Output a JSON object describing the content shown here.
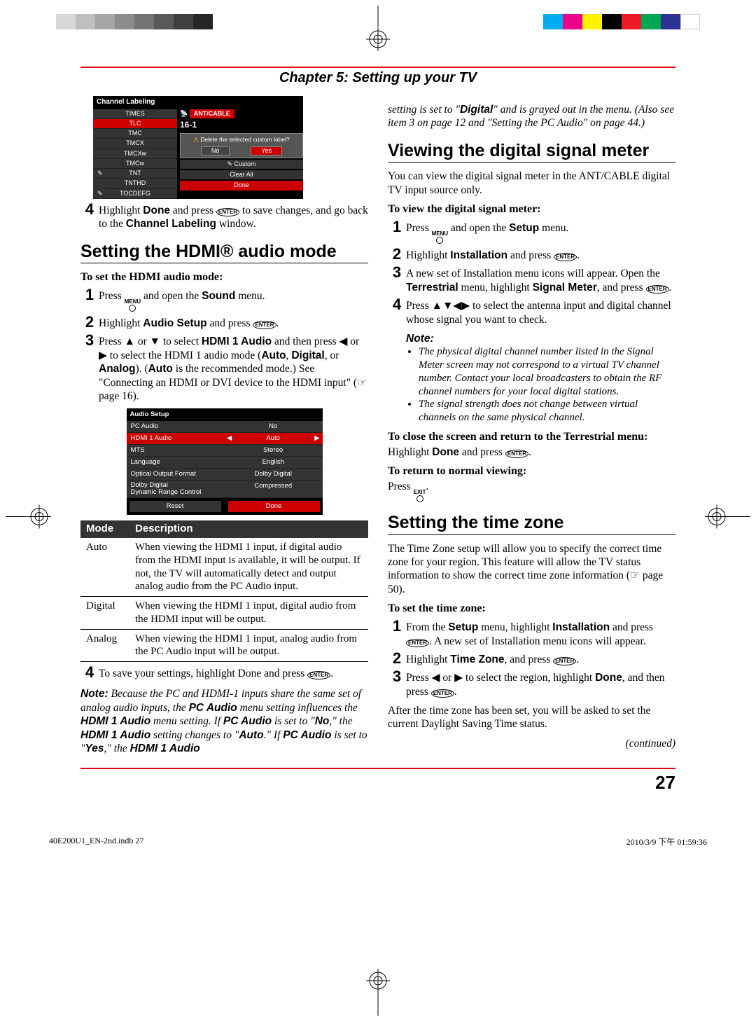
{
  "print_marks": {
    "colors_left": [
      "#d8d8d8",
      "#bfbfbf",
      "#a6a6a6",
      "#8c8c8c",
      "#737373",
      "#595959",
      "#404040",
      "#262626"
    ],
    "colors_right": [
      "#00aeef",
      "#ec008c",
      "#fff200",
      "#000000",
      "#ed1c24",
      "#00a651",
      "#2e3192",
      "#ffffff"
    ]
  },
  "chapter_title": "Chapter 5: Setting up your TV",
  "channel_labeling_ss": {
    "title": "Channel Labeling",
    "rows": [
      "TIMES",
      "TLC",
      "TMC",
      "TMCX",
      "TMCXw",
      "TMCw",
      "TNT",
      "TNTHD",
      "TOCDEFG"
    ],
    "ant": "ANT/CABLE",
    "channel": "16-1",
    "dialog": "Delete the selected custom label?",
    "no": "No",
    "yes": "Yes",
    "custom": "Custom",
    "clear": "Clear All",
    "done": "Done"
  },
  "left": {
    "step4_a": "Highlight ",
    "step4_b": "Done",
    "step4_c": " and press ",
    "step4_d": " to save changes, and go back to the ",
    "step4_e": "Channel Labeling",
    "step4_f": " window.",
    "h2_hdmi": "Setting the HDMI® audio mode",
    "sub_hdmi": "To set the HDMI audio mode:",
    "s1a": "Press ",
    "s1b": " and open the ",
    "s1c": "Sound",
    "s1d": " menu.",
    "s2a": "Highlight ",
    "s2b": "Audio Setup",
    "s2c": " and press ",
    "s3a": "Press ▲ or ▼ to select ",
    "s3b": "HDMI 1 Audio",
    "s3c": " and then press ◀ or ▶ to select the HDMI 1 audio mode (",
    "s3d": "Auto",
    "s3e": ", ",
    "s3f": "Digital",
    "s3g": ", or ",
    "s3h": "Analog",
    "s3i": "). (",
    "s3j": "Auto",
    "s3k": " is the recommended mode.) See \"Connecting an HDMI or DVI device to the HDMI input\" (☞ page 16).",
    "audio_ss": {
      "title": "Audio Setup",
      "rows": [
        {
          "l": "PC Audio",
          "r": "No"
        },
        {
          "l": "HDMI 1 Audio",
          "r": "Auto",
          "sel": true
        },
        {
          "l": "MTS",
          "r": "Stereo"
        },
        {
          "l": "Language",
          "r": "English"
        },
        {
          "l": "Optical Output Format",
          "r": "Dolby Digital"
        },
        {
          "l": "Dolby Digital Dynamic Range Control",
          "r": "Compressed"
        }
      ],
      "reset": "Reset",
      "done": "Done"
    },
    "table": {
      "h1": "Mode",
      "h2": "Description",
      "rows": [
        {
          "m": "Auto",
          "d": "When viewing the HDMI 1 input, if digital audio from the HDMI input is available, it will be output. If not, the TV will automatically detect and output analog audio from the PC Audio input."
        },
        {
          "m": "Digital",
          "d": "When viewing the HDMI 1 input, digital audio from the HDMI input will be output."
        },
        {
          "m": "Analog",
          "d": "When viewing the HDMI 1 input, analog audio from the PC Audio input will be output."
        }
      ]
    },
    "s4a": "To save your settings, highlight Done and press ",
    "note_label": "Note:",
    "note_text_parts": [
      " Because the PC and HDMI-1 inputs share the same set of analog audio inputs, the ",
      "PC Audio",
      " menu setting influences the ",
      "HDMI 1 Audio",
      " menu setting. If ",
      "PC Audio",
      " is set to \"",
      "No",
      ",\" the ",
      "HDMI 1 Audio",
      " setting changes to \"",
      "Auto",
      ".\" If ",
      "PC Audio",
      " is set to \"",
      "Yes",
      ",\" the ",
      "HDMI 1 Audio"
    ]
  },
  "right": {
    "cont_top": "setting is set to \"",
    "cont_b": "Digital",
    "cont_top2": "\" and is grayed out in the menu. (Also see item 3 on page 12 and \"Setting the PC Audio\" on page 44.)",
    "h2_signal": "Viewing the digital signal meter",
    "p_signal": "You can view the digital signal meter in the ANT/CABLE digital TV input source only.",
    "sub_view": "To view the digital signal meter:",
    "v1a": "Press ",
    "v1b": " and open the ",
    "v1c": "Setup",
    "v1d": " menu.",
    "v2a": "Highlight ",
    "v2b": "Installation",
    "v2c": " and press ",
    "v3a": "A new set of Installation menu icons will appear. Open the ",
    "v3b": "Terrestrial",
    "v3c": " menu, highlight ",
    "v3d": "Signal Meter",
    "v3e": ", and press ",
    "v4": "Press ▲▼◀▶ to select the antenna input and digital channel whose signal you want to check.",
    "note_label": "Note:",
    "notes": [
      "The physical digital channel number listed in the Signal Meter screen may not correspond to a virtual TV channel number. Contact your local broadcasters to obtain the RF channel numbers for your local digital stations.",
      "The signal strength does not change between virtual channels on the same physical channel."
    ],
    "sub_close": "To close the screen and return to the Terrestrial menu:",
    "close_a": "Highlight ",
    "close_b": "Done",
    "close_c": " and press ",
    "sub_return": "To return to normal viewing:",
    "return_a": "Press ",
    "h2_tz": "Setting the time zone",
    "p_tz": "The Time Zone setup will allow you to specify the correct time zone for your region. This feature will allow the TV status information to show the correct time zone information (☞ page 50).",
    "sub_tz": "To set the time zone:",
    "t1a": "From the ",
    "t1b": "Setup",
    "t1c": " menu, highlight ",
    "t1d": "Installation",
    "t1e": " and press ",
    "t1f": ". A new set of Installation menu icons will appear.",
    "t2a": "Highlight ",
    "t2b": "Time Zone",
    "t2c": ", and press ",
    "t3a": "Press ◀ or ▶ to select the region, highlight ",
    "t3b": "Done",
    "t3c": ", and then press ",
    "after": "After the time zone has been set, you will be asked to set the current Daylight Saving Time status.",
    "continued": "(continued)"
  },
  "page_number": "27",
  "footer": {
    "file": "40E200U1_EN-2nd.indb   27",
    "date": "2010/3/9   下午 01:59:36"
  },
  "labels": {
    "menu": "MENU",
    "enter": "ENTER",
    "exit": "EXIT"
  }
}
